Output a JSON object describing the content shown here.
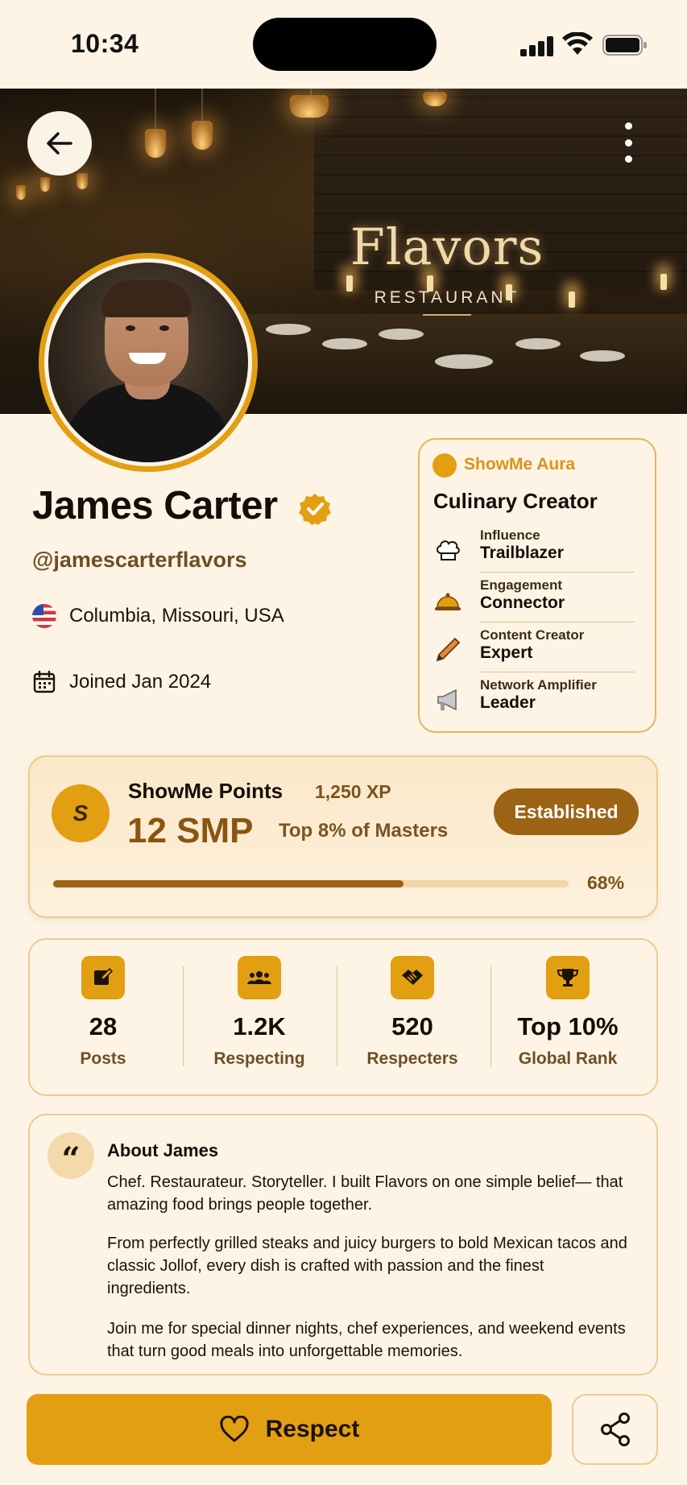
{
  "status_bar": {
    "time": "10:34"
  },
  "cover": {
    "brand_name": "Flavors",
    "brand_subtitle": "RESTAURANT"
  },
  "icons": {
    "back": "arrow-left-icon",
    "more": "more-vertical-icon",
    "verified": "verified-badge-icon",
    "flag": "us-flag-icon",
    "calendar": "calendar-icon",
    "heart": "heart-icon",
    "share": "share-icon"
  },
  "profile": {
    "name": "James Carter",
    "handle": "@jamescarterflavors",
    "location": "Columbia, Missouri, USA",
    "joined": "Joined Jan 2024"
  },
  "aura": {
    "title": "ShowMe Aura",
    "role": "Culinary Creator",
    "items": [
      {
        "label": "Influence",
        "value": "Trailblazer",
        "icon": "chef-hat-icon"
      },
      {
        "label": "Engagement",
        "value": "Connector",
        "icon": "cloche-icon"
      },
      {
        "label": "Content Creator",
        "value": "Expert",
        "icon": "pencil-icon"
      },
      {
        "label": "Network Amplifier",
        "value": "Leader",
        "icon": "megaphone-icon"
      }
    ]
  },
  "points": {
    "coin_symbol": "S",
    "title": "ShowMe Points",
    "xp": "1,250 XP",
    "amount": "12 SMP",
    "rank": "Top 8% of Masters",
    "status": "Established",
    "progress": 0.68,
    "progress_label": "68%"
  },
  "stats": [
    {
      "value": "28",
      "label": "Posts",
      "icon": "edit-icon"
    },
    {
      "value": "1.2K",
      "label": "Respecting",
      "icon": "group-icon"
    },
    {
      "value": "520",
      "label": "Respecters",
      "icon": "handshake-icon"
    },
    {
      "value": "Top 10%",
      "label": "Global Rank",
      "icon": "trophy-icon"
    }
  ],
  "about": {
    "quote_mark": "“",
    "title": "About James",
    "paragraphs": [
      "Chef. Restaurateur. Storyteller. I built Flavors on one simple belief— that amazing food brings people together.",
      "From perfectly grilled steaks and juicy burgers to bold Mexican tacos and classic Jollof, every dish is crafted with passion and the finest ingredients.",
      "Join me for special dinner nights, chef experiences, and weekend events that turn good meals into unforgettable memories."
    ]
  },
  "actions": {
    "respect_label": "Respect"
  },
  "colors": {
    "accent": "#e39f12",
    "accent_dark": "#9c6314",
    "background": "#fdf4e6",
    "card_border": "#eccb8d"
  }
}
